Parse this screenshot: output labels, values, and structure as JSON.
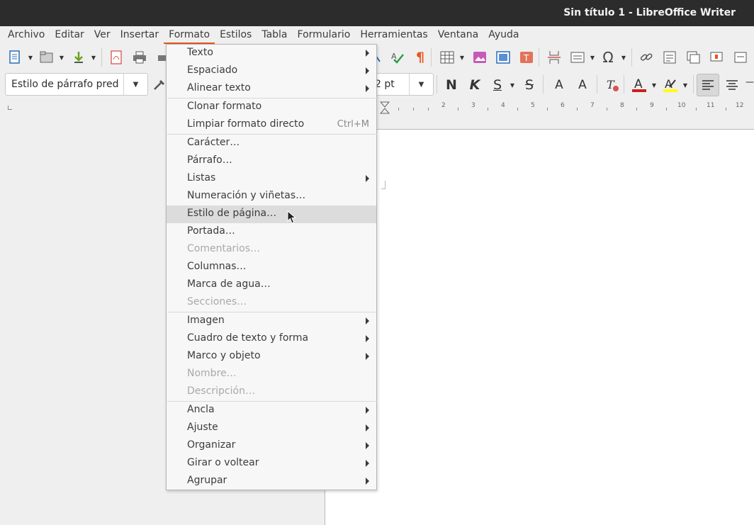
{
  "window": {
    "title": "Sin título 1 - LibreOffice Writer"
  },
  "menubar": {
    "items": [
      {
        "label": "Archivo"
      },
      {
        "label": "Editar"
      },
      {
        "label": "Ver"
      },
      {
        "label": "Insertar"
      },
      {
        "label": "Formato"
      },
      {
        "label": "Estilos"
      },
      {
        "label": "Tabla"
      },
      {
        "label": "Formulario"
      },
      {
        "label": "Herramientas"
      },
      {
        "label": "Ventana"
      },
      {
        "label": "Ayuda"
      }
    ],
    "active": "Formato"
  },
  "toolbar": {
    "paragraph_style": "Estilo de párrafo pred",
    "font_size": "2 pt",
    "bold_label": "N",
    "italic_label": "K",
    "underline_label": "S",
    "strike_label": "S",
    "superscript_label": "A",
    "subscript_label": "A",
    "omega_label": "Ω",
    "pilcrow_label": "¶"
  },
  "ruler": {
    "numbers": [
      "1",
      "2",
      "3",
      "4",
      "5",
      "6",
      "7",
      "8",
      "9",
      "10",
      "11",
      "12"
    ]
  },
  "format_menu": {
    "items": [
      {
        "label": "Texto",
        "submenu": true
      },
      {
        "label": "Espaciado",
        "submenu": true
      },
      {
        "label": "Alinear texto",
        "submenu": true
      },
      {
        "label": "Clonar formato"
      },
      {
        "label": "Limpiar formato directo",
        "shortcut": "Ctrl+M"
      },
      {
        "label": "Carácter…"
      },
      {
        "label": "Párrafo…"
      },
      {
        "label": "Listas",
        "submenu": true
      },
      {
        "label": "Numeración y viñetas…"
      },
      {
        "label": "Estilo de página…",
        "highlighted": true
      },
      {
        "label": "Portada…"
      },
      {
        "label": "Comentarios…",
        "disabled": true
      },
      {
        "label": "Columnas…"
      },
      {
        "label": "Marca de agua…"
      },
      {
        "label": "Secciones…",
        "disabled": true
      },
      {
        "label": "Imagen",
        "submenu": true
      },
      {
        "label": "Cuadro de texto y forma",
        "submenu": true
      },
      {
        "label": "Marco y objeto",
        "submenu": true
      },
      {
        "label": "Nombre…",
        "disabled": true
      },
      {
        "label": "Descripción…",
        "disabled": true
      },
      {
        "label": "Ancla",
        "submenu": true
      },
      {
        "label": "Ajuste",
        "submenu": true
      },
      {
        "label": "Organizar",
        "submenu": true
      },
      {
        "label": "Girar o voltear",
        "submenu": true
      },
      {
        "label": "Agrupar",
        "submenu": true
      }
    ]
  },
  "colors": {
    "accent": "#e95420",
    "titlebar": "#2c2c2c",
    "font_color_bar": "#c9211e",
    "highlight_bar": "#ffff00"
  }
}
